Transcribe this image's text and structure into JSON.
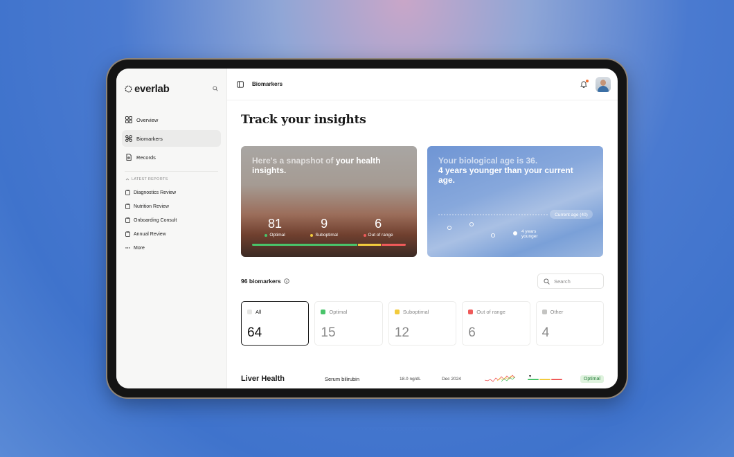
{
  "brand": {
    "name": "everlab"
  },
  "sidebar": {
    "items": [
      {
        "label": "Overview",
        "icon": "grid-icon"
      },
      {
        "label": "Biomarkers",
        "icon": "molecule-icon"
      },
      {
        "label": "Records",
        "icon": "document-icon"
      }
    ],
    "section_label": "LATEST REPORTS",
    "reports": [
      {
        "label": "Diagnostics Review"
      },
      {
        "label": "Nutrition Review"
      },
      {
        "label": "Onboarding Consult"
      },
      {
        "label": "Annual Review"
      }
    ],
    "more_label": "More"
  },
  "header": {
    "breadcrumb": "Biomarkers"
  },
  "main": {
    "title": "Track your insights",
    "health_card": {
      "text_dim": "Here's a snapshot of",
      "text_bold": "your health insights.",
      "stats": [
        {
          "value": "81",
          "label": "Optimal",
          "color": "#49c46a"
        },
        {
          "value": "9",
          "label": "Suboptimal",
          "color": "#f2cb3d"
        },
        {
          "value": "6",
          "label": "Out of range",
          "color": "#ef5a5a"
        }
      ],
      "bar_fractions": [
        0.69,
        0.15,
        0.16
      ]
    },
    "age_card": {
      "text_dim": "Your biological age is 36.",
      "text_bold": "4 years younger than your current age.",
      "current_age_label": "Current age (40)",
      "delta_label_1": "4 years",
      "delta_label_2": "younger"
    },
    "biomarker_count": "96 biomarkers",
    "search_placeholder": "Search",
    "filters": [
      {
        "label": "All",
        "count": "64",
        "color": "#e4e4e2"
      },
      {
        "label": "Optimal",
        "count": "15",
        "color": "#49c46a"
      },
      {
        "label": "Suboptimal",
        "count": "12",
        "color": "#f2cb3d"
      },
      {
        "label": "Out of range",
        "count": "6",
        "color": "#ef5a5a"
      },
      {
        "label": "Other",
        "count": "4",
        "color": "#c4c4c2"
      }
    ],
    "row": {
      "group": "Liver Health",
      "biomarker": "Serum bilirubin",
      "value": "18.0 ng/dL",
      "date": "Dec 2024",
      "status": "Optimal"
    }
  }
}
